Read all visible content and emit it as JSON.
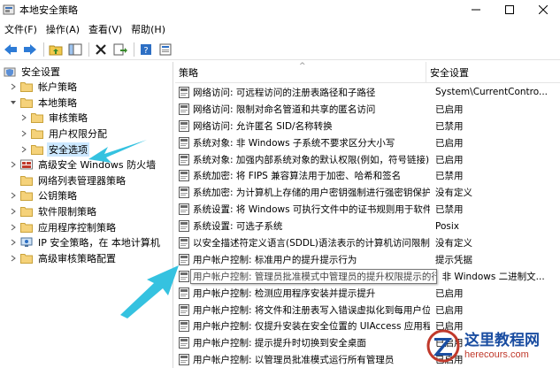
{
  "window": {
    "title": "本地安全策略"
  },
  "menu": [
    "文件(F)",
    "操作(A)",
    "查看(V)",
    "帮助(H)"
  ],
  "tree": [
    {
      "label": "安全设置",
      "level": 0,
      "expanded": true,
      "icon": "shield-folder-icon"
    },
    {
      "label": "帐户策略",
      "level": 1,
      "expanded": false,
      "icon": "folder-icon"
    },
    {
      "label": "本地策略",
      "level": 1,
      "expanded": true,
      "icon": "folder-icon"
    },
    {
      "label": "审核策略",
      "level": 2,
      "expanded": false,
      "icon": "folder-icon"
    },
    {
      "label": "用户权限分配",
      "level": 2,
      "expanded": false,
      "icon": "folder-icon"
    },
    {
      "label": "安全选项",
      "level": 2,
      "expanded": false,
      "icon": "folder-icon",
      "selected": true
    },
    {
      "label": "高级安全 Windows 防火墙",
      "level": 1,
      "expanded": false,
      "icon": "firewall-icon"
    },
    {
      "label": "网络列表管理器策略",
      "level": 1,
      "expanded": null,
      "icon": "folder-icon"
    },
    {
      "label": "公钥策略",
      "level": 1,
      "expanded": false,
      "icon": "folder-icon"
    },
    {
      "label": "软件限制策略",
      "level": 1,
      "expanded": false,
      "icon": "folder-icon"
    },
    {
      "label": "应用程序控制策略",
      "level": 1,
      "expanded": false,
      "icon": "folder-icon"
    },
    {
      "label": "IP 安全策略，在 本地计算机",
      "level": 1,
      "expanded": false,
      "icon": "ip-security-icon"
    },
    {
      "label": "高级审核策略配置",
      "level": 1,
      "expanded": false,
      "icon": "folder-icon"
    }
  ],
  "columns": {
    "policy": "策略",
    "setting": "安全设置"
  },
  "rows": [
    {
      "policy": "网络访问: 可远程访问的注册表路径和子路径",
      "setting": "System\\CurrentContro..."
    },
    {
      "policy": "网络访问: 限制对命名管道和共享的匿名访问",
      "setting": "已启用"
    },
    {
      "policy": "网络访问: 允许匿名 SID/名称转换",
      "setting": "已禁用"
    },
    {
      "policy": "系统对象: 非 Windows 子系统不要求区分大小写",
      "setting": "已启用"
    },
    {
      "policy": "系统对象: 加强内部系统对象的默认权限(例如，符号链接)",
      "setting": "已启用"
    },
    {
      "policy": "系统加密: 将 FIPS 兼容算法用于加密、哈希和签名",
      "setting": "已禁用"
    },
    {
      "policy": "系统加密: 为计算机上存储的用户密钥强制进行强密钥保护",
      "setting": "没有定义"
    },
    {
      "policy": "系统设置: 将 Windows 可执行文件中的证书规则用于软件...",
      "setting": "已禁用"
    },
    {
      "policy": "系统设置: 可选子系统",
      "setting": "Posix"
    },
    {
      "policy": "以安全描述符定义语言(SDDL)语法表示的计算机访问限制",
      "setting": "没有定义"
    },
    {
      "policy": "用户帐户控制: 标准用户的提升提示行为",
      "setting": "提示凭据"
    },
    {
      "policy": "用户帐户控制: 管理员批准模式中管理员的提升权限提示的行为",
      "setting": "非 Windows 二进制文...",
      "highlighted": true
    },
    {
      "policy": "用户帐户控制: 检测应用程序安装并提示提升",
      "setting": "已启用"
    },
    {
      "policy": "用户帐户控制: 将文件和注册表写入错误虚拟化到每用户位置",
      "setting": "已启用"
    },
    {
      "policy": "用户帐户控制: 仅提升安装在安全位置的 UIAccess 应用程序",
      "setting": "已启用"
    },
    {
      "policy": "用户帐户控制: 提示提升时切换到安全桌面",
      "setting": "已启用"
    },
    {
      "policy": "用户帐户控制: 以管理员批准模式运行所有管理员",
      "setting": "已启用"
    }
  ],
  "watermark": {
    "cn": "这里教程网",
    "en": "herecours.com"
  },
  "colors": {
    "arrow": "#35c2e0",
    "selection": "#cce8ff",
    "watermark_blue": "#1a4da1",
    "watermark_red": "#c0392b"
  }
}
